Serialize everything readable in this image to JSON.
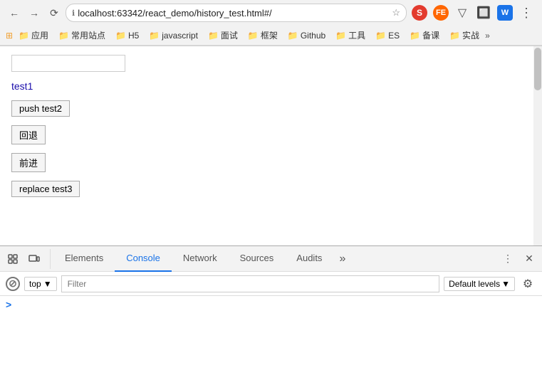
{
  "browser": {
    "back_disabled": false,
    "forward_disabled": false,
    "address": "localhost:63342/react_demo/history_test.html#/",
    "address_selected_part": "test.html#/",
    "address_display": "localhost:63342/react_demo/history_test.html#/"
  },
  "bookmarks": {
    "items": [
      {
        "label": "应用",
        "type": "folder"
      },
      {
        "label": "常用站点",
        "type": "folder"
      },
      {
        "label": "H5",
        "type": "folder"
      },
      {
        "label": "javascript",
        "type": "folder"
      },
      {
        "label": "面试",
        "type": "folder"
      },
      {
        "label": "框架",
        "type": "folder"
      },
      {
        "label": "Github",
        "type": "folder"
      },
      {
        "label": "工具",
        "type": "folder"
      },
      {
        "label": "ES",
        "type": "folder"
      },
      {
        "label": "备课",
        "type": "folder"
      },
      {
        "label": "实战",
        "type": "folder"
      }
    ],
    "more_label": "»"
  },
  "page": {
    "search_placeholder": "",
    "link_text": "test1",
    "btn_push": "push test2",
    "btn_back": "回退",
    "btn_forward": "前进",
    "btn_replace": "replace test3"
  },
  "devtools": {
    "tabs": [
      {
        "label": "Elements",
        "active": false
      },
      {
        "label": "Console",
        "active": true
      },
      {
        "label": "Network",
        "active": false
      },
      {
        "label": "Sources",
        "active": false
      },
      {
        "label": "Audits",
        "active": false
      }
    ],
    "more_label": "»",
    "console": {
      "context": "top",
      "filter_placeholder": "Filter",
      "levels_label": "Default levels",
      "caret": ">"
    }
  }
}
